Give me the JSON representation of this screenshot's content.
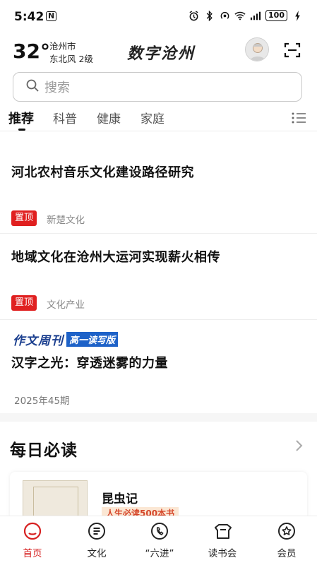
{
  "status_bar": {
    "time": "5:42",
    "n_badge": "N",
    "battery": "100"
  },
  "header": {
    "temperature": "32°",
    "city": "沧州市",
    "wind": "东北风  2级",
    "brand": "数字沧州"
  },
  "search": {
    "placeholder": "搜索"
  },
  "tabs": [
    {
      "label": "推荐",
      "active": true
    },
    {
      "label": "科普",
      "active": false
    },
    {
      "label": "健康",
      "active": false
    },
    {
      "label": "家庭",
      "active": false
    }
  ],
  "feed": [
    {
      "title": "河北农村音乐文化建设路径研究",
      "badge": "置顶",
      "source": "新楚文化"
    },
    {
      "title": "地域文化在沧州大运河实现薪火相传",
      "badge": "置顶",
      "source": "文化产业"
    },
    {
      "banner_title": "作文周刊",
      "banner_tag": "高一读写版",
      "title": "汉字之光：穿透迷雾的力量",
      "issue": "2025年45期"
    }
  ],
  "daily": {
    "section_title": "每日必读",
    "book_name": "昆虫记",
    "book_tag": "人生必读500本书"
  },
  "bottom_nav": [
    {
      "label": "首页",
      "icon": "home-icon",
      "active": true
    },
    {
      "label": "文化",
      "icon": "culture-icon",
      "active": false
    },
    {
      "label": "“六进”",
      "icon": "six-entries-icon",
      "active": false
    },
    {
      "label": "读书会",
      "icon": "book-club-icon",
      "active": false
    },
    {
      "label": "会员",
      "icon": "member-icon",
      "active": false
    }
  ],
  "colors": {
    "accent_red": "#e02020",
    "nav_active": "#d61f1f",
    "banner_blue": "#1b3f8f"
  }
}
